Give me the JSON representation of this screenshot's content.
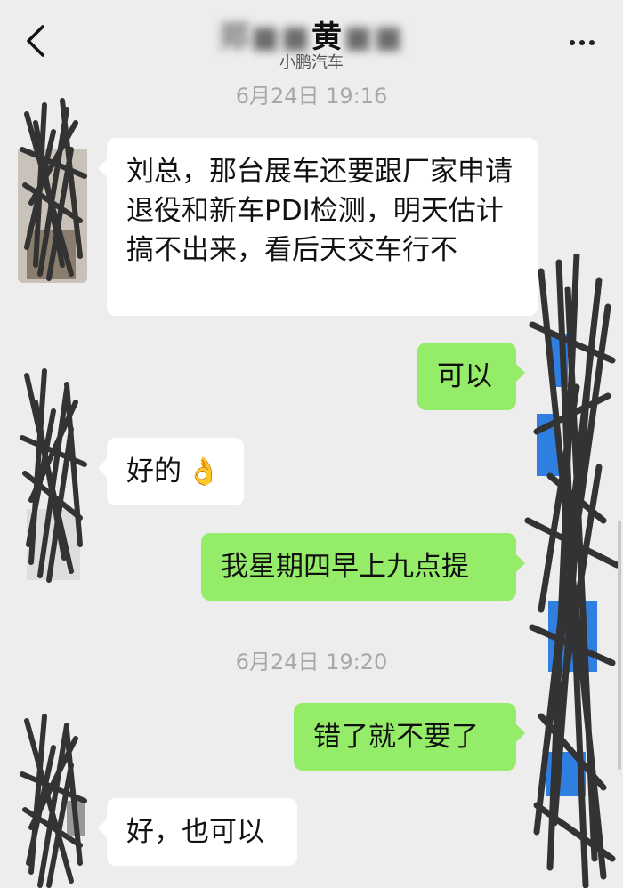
{
  "header": {
    "title_visible": "黄",
    "subtitle": "小鹏汽车"
  },
  "icons": {
    "back": "chevron-left-icon",
    "more": "more-dots-icon"
  },
  "colors": {
    "background": "#ededed",
    "incoming_bubble": "#ffffff",
    "outgoing_bubble": "#95ec69",
    "timestamp": "#a8a8a8"
  },
  "chat": {
    "timestamp_1": "6月24日 19:16",
    "timestamp_2": "6月24日 19:20",
    "messages": [
      {
        "side": "left",
        "text": "刘总，那台展车还要跟厂家申请退役和新车PDI检测，明天估计搞不出来，看后天交车行不"
      },
      {
        "side": "right",
        "text": "可以"
      },
      {
        "side": "left",
        "text": "好的",
        "emoji": "👌"
      },
      {
        "side": "right",
        "text": "我星期四早上九点提"
      },
      {
        "side": "right",
        "text": "错了就不要了"
      },
      {
        "side": "left",
        "text": "好，也可以"
      }
    ]
  }
}
